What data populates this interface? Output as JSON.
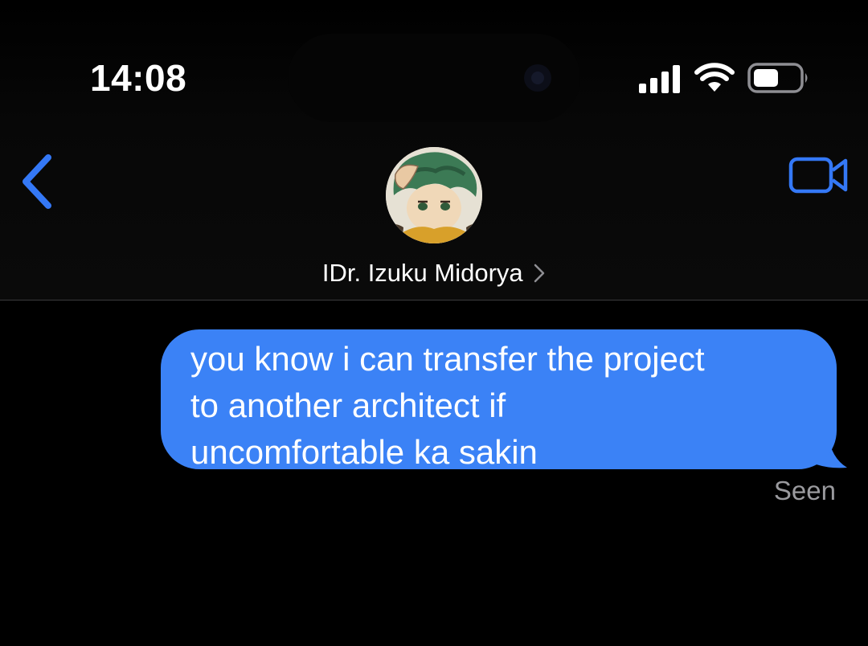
{
  "status_bar": {
    "time": "14:08",
    "icons": [
      "signal-icon",
      "wifi-icon",
      "battery-icon"
    ]
  },
  "header": {
    "contact_name": "IDr. Izuku Midorya",
    "avatar": "contact-avatar",
    "back_icon": "chevron-left-icon",
    "video_icon": "video-camera-icon"
  },
  "conversation": {
    "messages": [
      {
        "direction": "outgoing",
        "text": "you know i can transfer the project\nto another architect if\nuncomfortable ka sakin"
      }
    ],
    "receipt": "Seen"
  },
  "colors": {
    "accent": "#3478f6",
    "bubble": "#3b82f6",
    "background": "#000000",
    "receipt_text": "#9a9a9e"
  }
}
